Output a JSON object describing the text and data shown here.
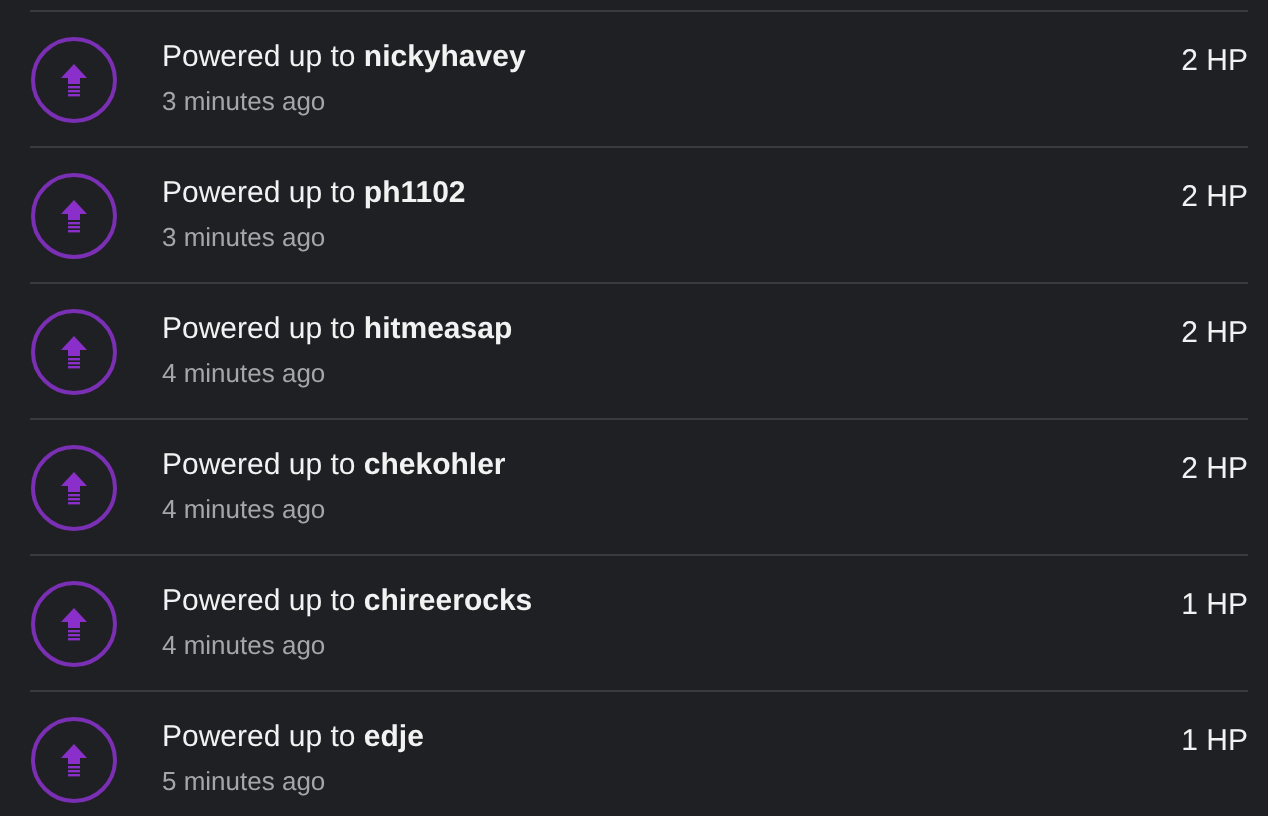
{
  "activities": [
    {
      "title": "Powered up to **nickyhavey**",
      "time": "3 minutes ago",
      "amount": "2 HP"
    },
    {
      "title": "Powered up to **ph1102**",
      "time": "3 minutes ago",
      "amount": "2 HP"
    },
    {
      "title": "Powered up to **hitmeasap**",
      "time": "4 minutes ago",
      "amount": "2 HP"
    },
    {
      "title": "Powered up to **chekohler**",
      "time": "4 minutes ago",
      "amount": "2 HP"
    },
    {
      "title": "Powered up to **chireerocks**",
      "time": "4 minutes ago",
      "amount": "1 HP"
    },
    {
      "title": "Powered up to **edje**",
      "time": "5 minutes ago",
      "amount": "1 HP"
    }
  ]
}
